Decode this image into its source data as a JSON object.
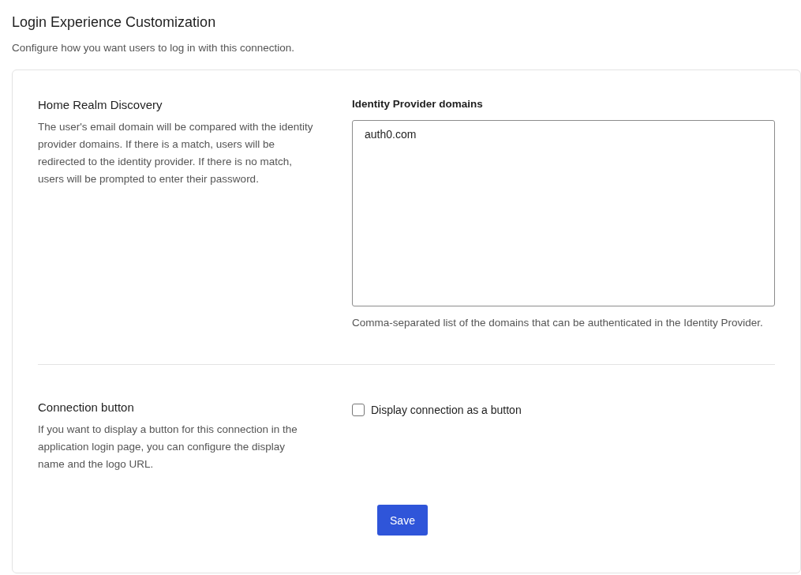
{
  "title": "Login Experience Customization",
  "subtitle": "Configure how you want users to log in with this connection.",
  "sections": [
    {
      "kind": "textarea",
      "heading": "Home Realm Discovery",
      "description": "The user's email domain will be compared with the identity provider domains. If there is a match, users will be redirected to the identity provider. If there is no match, users will be prompted to enter their password.",
      "field_label": "Identity Provider domains",
      "value": "auth0.com",
      "help": "Comma-separated list of the domains that can be authenticated in the Identity Provider."
    },
    {
      "kind": "checkbox",
      "heading": "Connection button",
      "description": "If you want to display a button for this connection in the application login page, you can configure the display name and the logo URL.",
      "label": "Display connection as a button",
      "checked": false
    }
  ],
  "save_button": "Save"
}
